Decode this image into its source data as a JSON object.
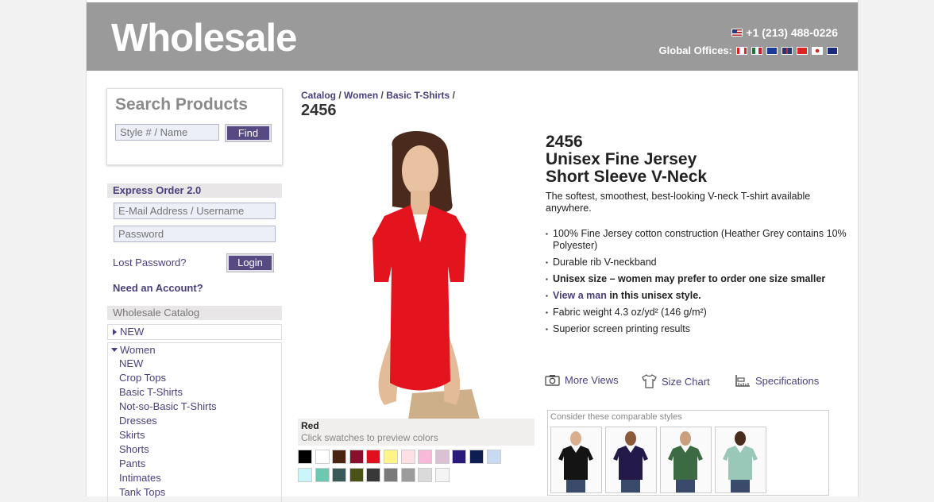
{
  "header": {
    "logo": "Wholesale",
    "phone": "+1 (213) 488-0226",
    "global_offices_label": "Global Offices:",
    "flags": [
      "canada-flag-icon",
      "mexico-flag-icon",
      "eu-flag-icon",
      "uk-flag-icon",
      "switzerland-flag-icon",
      "japan-flag-icon",
      "australia-flag-icon"
    ]
  },
  "search": {
    "title": "Search Products",
    "placeholder": "Style # / Name",
    "button": "Find"
  },
  "express": {
    "title": "Express Order 2.0",
    "email_placeholder": "E-Mail Address / Username",
    "password_placeholder": "Password",
    "lost_password": "Lost Password?",
    "login_button": "Login",
    "need_account": "Need an Account?"
  },
  "catalog": {
    "title": "Wholesale Catalog",
    "new_label": "NEW",
    "women_label": "Women",
    "women_items": [
      "NEW",
      "Crop Tops",
      "Basic T-Shirts",
      "Not-so-Basic T-Shirts",
      "Dresses",
      "Skirts",
      "Shorts",
      "Pants",
      "Intimates",
      "Tank Tops"
    ]
  },
  "breadcrumb": {
    "items": [
      "Catalog",
      "Women",
      "Basic T-Shirts"
    ],
    "separator": "/",
    "current": "2456"
  },
  "product": {
    "style": "2456",
    "name_line1": "Unisex Fine Jersey",
    "name_line2": "Short Sleeve V-Neck",
    "description": "The softest, smoothest, best-looking V-neck T-shirt available anywhere.",
    "bullets": {
      "b1": "100% Fine Jersey cotton construction (Heather Grey contains 10% Polyester)",
      "b2": "Durable rib V-neckband",
      "b3": "Unisex size – women may prefer to order one size smaller",
      "b4_link": "View a man",
      "b4_rest": " in this unisex style.",
      "b5": "Fabric weight 4.3 oz/yd² (146 g/m²)",
      "b6": "Superior screen printing results"
    },
    "selected_color": "Red",
    "swatch_hint": "Click swatches to preview colors",
    "swatches_row1": [
      "#000000",
      "#ffffff",
      "#4a2412",
      "#8a0e2e",
      "#e0101e",
      "#fdf58a",
      "#fde0e4",
      "#f8b8d8",
      "#dcc0d6",
      "#2a1a7a",
      "#0e1e52",
      "#c8daf2"
    ],
    "swatches_row2": [
      "#c8f6fa",
      "#6cc8b0",
      "#3a5a58",
      "#4a5218",
      "#383838",
      "#7a7a7a",
      "#9c9c9c",
      "#dadada",
      "#f4f4f4"
    ],
    "shirt_color": "#e3141e"
  },
  "tools": {
    "more_views": "More Views",
    "size_chart": "Size Chart",
    "specifications": "Specifications"
  },
  "compare": {
    "title": "Consider these comparable styles",
    "shirt_colors": [
      "#141414",
      "#241a4a",
      "#3c6a42",
      "#9ac8b8"
    ]
  }
}
